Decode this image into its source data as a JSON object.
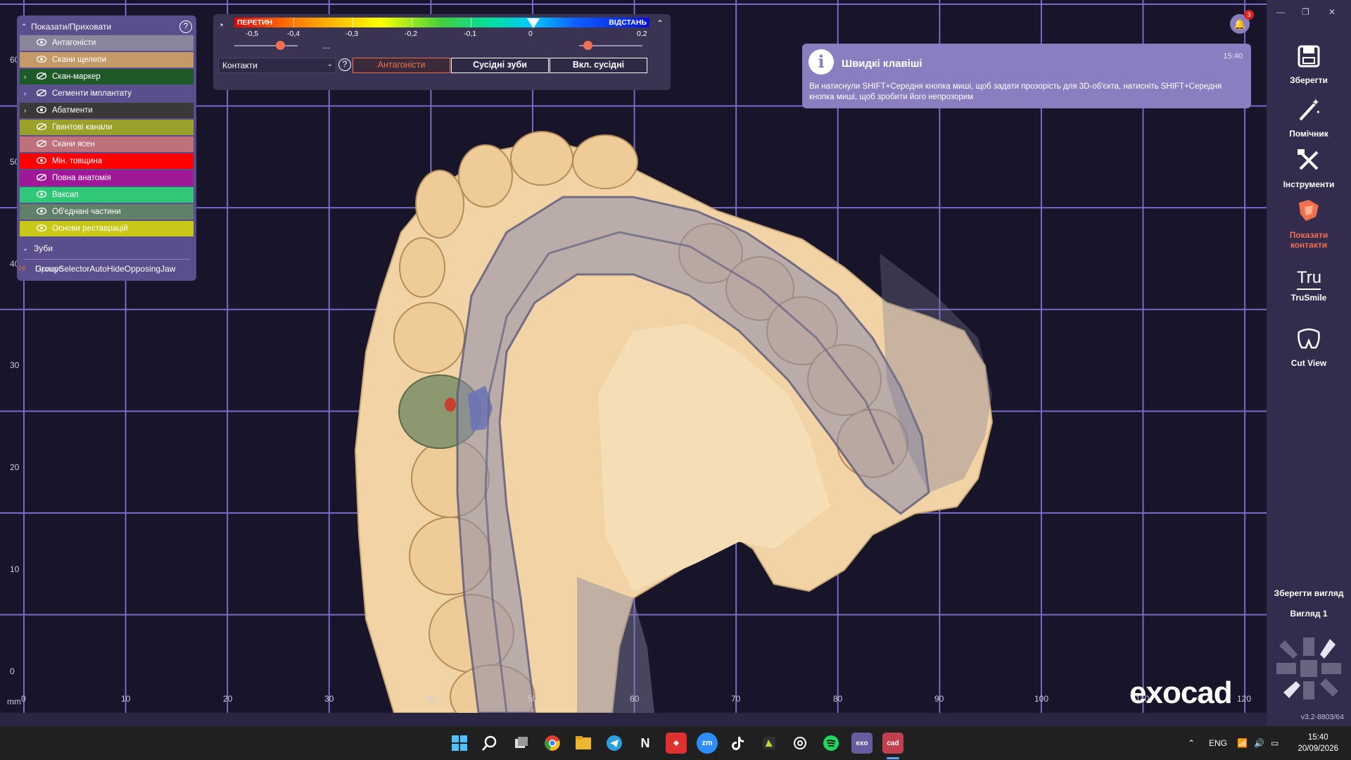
{
  "layers_panel": {
    "header": "Показати/Приховати",
    "help": "?",
    "items": [
      {
        "label": "Антагоністи",
        "color": "#8a869c",
        "expand": false,
        "eye": "visible"
      },
      {
        "label": "Скани щелепи",
        "color": "#c49a68",
        "expand": false,
        "eye": "visible"
      },
      {
        "label": "Скан-маркер",
        "color": "#1e5a28",
        "expand": true,
        "eye": "hidden"
      },
      {
        "label": "Сегменти імплантату",
        "color": "#5a4e8c",
        "expand": true,
        "eye": "hidden"
      },
      {
        "label": "Абатменти",
        "color": "#3a3838",
        "expand": true,
        "eye": "visible"
      },
      {
        "label": "Гвинтові канали",
        "color": "#9aa028",
        "expand": false,
        "eye": "hidden"
      },
      {
        "label": "Скани ясен",
        "color": "#c07078",
        "expand": false,
        "eye": "hidden"
      },
      {
        "label": "Мін. товщина",
        "color": "#ff0000",
        "expand": false,
        "eye": "visible"
      },
      {
        "label": "Повна анатомія",
        "color": "#a01898",
        "expand": false,
        "eye": "hidden"
      },
      {
        "label": "Ваксап",
        "color": "#30c878",
        "expand": false,
        "eye": "visible"
      },
      {
        "label": "Об'єднані частини",
        "color": "#608068",
        "expand": false,
        "eye": "visible"
      },
      {
        "label": "Основи реставрацій",
        "color": "#c8c818",
        "expand": false,
        "eye": "visible"
      }
    ],
    "teeth_header": "Зуби",
    "overlap_tag": "ce",
    "overlap_text_1": "GroupSelectorAutoHideOpposingJaw",
    "overlap_text_2": "Прикус"
  },
  "scale_panel": {
    "left_label": "ПЕРЕТИН",
    "right_label": "ВІДСТАНЬ",
    "ticks": [
      "-0,5",
      "-0,4",
      "-0,3",
      "-0,2",
      "-0,1",
      "0",
      "0,2"
    ],
    "ellipsis": "...",
    "select_value": "Контакти",
    "help": "?",
    "buttons": [
      "Антагоністи",
      "Сусідні зуби",
      "Вкл. сусідні"
    ],
    "active_button": "Антагоністи"
  },
  "notification": {
    "title": "Швидкі клавіші",
    "time": "15:40",
    "body": "Ви натиснули SHIFT+Середня кнопка миші, щоб задати прозорість для 3D-об'єкта, натисніть SHIFT+Середня кнопка миші, щоб зробити його непрозорим",
    "badge": "3"
  },
  "axes": {
    "x_labels": [
      "0",
      "10",
      "20",
      "30",
      "40",
      "50",
      "60",
      "70",
      "80",
      "90",
      "100",
      "110",
      "120"
    ],
    "y_labels": [
      "0",
      "10",
      "20",
      "30",
      "40",
      "50",
      "60"
    ],
    "unit": "mm"
  },
  "right_toolbar": {
    "tools": [
      {
        "label": "Зберегти",
        "icon": "save-icon"
      },
      {
        "label": "Помічник",
        "icon": "wizard-icon"
      },
      {
        "label": "Інструменти",
        "icon": "tools-icon"
      },
      {
        "label": "Показати контакти",
        "icon": "contacts-icon",
        "accent": true
      },
      {
        "label": "TruSmile",
        "icon": "trusmile-icon"
      },
      {
        "label": "Cut View",
        "icon": "cut-view-icon"
      }
    ],
    "trusmile_logo": "Tru",
    "save_view": "Зберегти вигляд",
    "view_name": "Вигляд 1",
    "version": "v3.2-8803/64"
  },
  "brand": {
    "logo": "exocad"
  },
  "taskbar": {
    "apps": [
      {
        "name": "windows-start",
        "label": ""
      },
      {
        "name": "search",
        "label": ""
      },
      {
        "name": "task-view",
        "label": ""
      },
      {
        "name": "chrome",
        "label": ""
      },
      {
        "name": "file-explorer",
        "label": ""
      },
      {
        "name": "telegram",
        "label": ""
      },
      {
        "name": "notion",
        "label": "N"
      },
      {
        "name": "anydesk",
        "label": ""
      },
      {
        "name": "zoom",
        "label": "zm"
      },
      {
        "name": "tiktok",
        "label": ""
      },
      {
        "name": "app-green",
        "label": ""
      },
      {
        "name": "chatgpt",
        "label": ""
      },
      {
        "name": "spotify",
        "label": ""
      },
      {
        "name": "exocad",
        "label": "exo"
      },
      {
        "name": "exocad-cad",
        "label": "cad"
      }
    ],
    "lang": "ENG",
    "time": "15:40",
    "date": "20/09/2026"
  },
  "colors": {
    "accent": "#f07050",
    "panel": "#5a4e8c",
    "grid": "#7a6ac8"
  }
}
